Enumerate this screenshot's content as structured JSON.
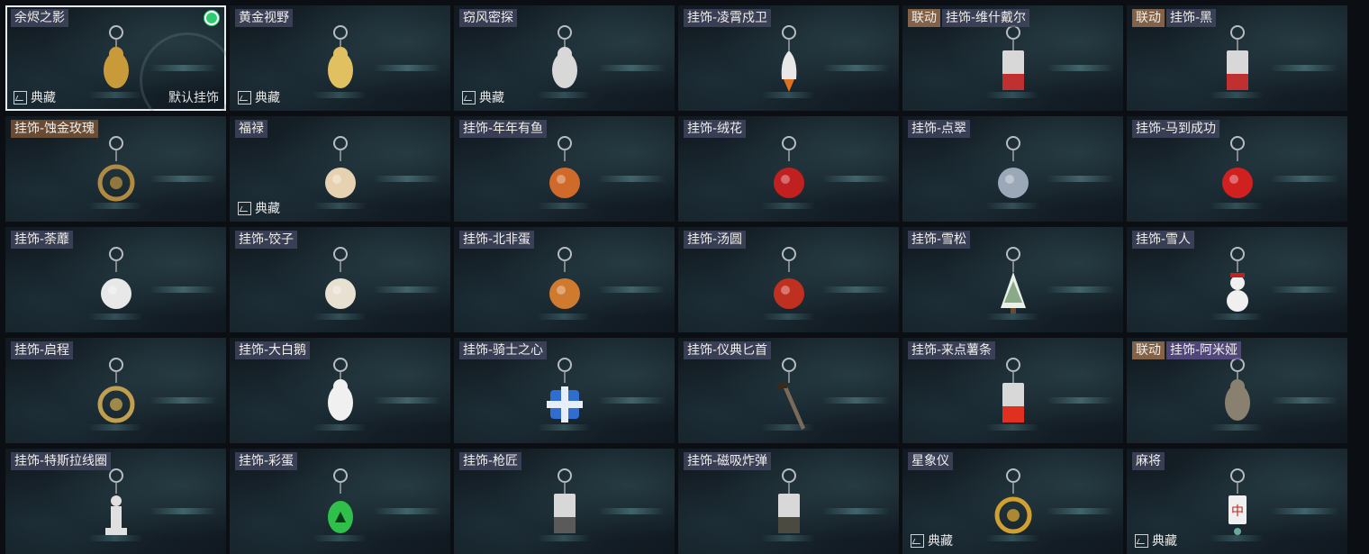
{
  "items": [
    {
      "name": "余烬之影",
      "collab": "",
      "tag": "",
      "collection": "典藏",
      "default_label": "默认挂饰",
      "selected": true,
      "icon": "ember-shadow-charm-icon",
      "color": "#c99a3a",
      "shape": "figure"
    },
    {
      "name": "黄金视野",
      "collab": "",
      "tag": "",
      "collection": "典藏",
      "icon": "golden-vision-charm-icon",
      "color": "#e0c060",
      "shape": "figure"
    },
    {
      "name": "窃风密探",
      "collab": "",
      "tag": "",
      "collection": "典藏",
      "icon": "wind-spy-charm-icon",
      "color": "#d8d8d8",
      "shape": "figure"
    },
    {
      "name": "挂饰-凌霄戍卫",
      "collab": "",
      "tag": "",
      "collection": "",
      "icon": "rocket-charm-icon",
      "color": "#e8e8e8",
      "shape": "rocket"
    },
    {
      "name": "挂饰-维什戴尔",
      "collab": "联动",
      "tag": "",
      "collection": "",
      "icon": "card-charm-icon",
      "color": "#c03030",
      "shape": "card"
    },
    {
      "name": "挂饰-黑",
      "collab": "联动",
      "tag": "",
      "collection": "",
      "icon": "card-charm-icon",
      "color": "#c03030",
      "shape": "card"
    },
    {
      "name": "挂饰-蚀金玫瑰",
      "collab": "",
      "tag": "gold",
      "collection": "",
      "icon": "gold-rose-charm-icon",
      "color": "#b08a40",
      "shape": "ring"
    },
    {
      "name": "福禄",
      "collab": "",
      "tag": "",
      "collection": "典藏",
      "icon": "gourd-charm-icon",
      "color": "#e6d2b0",
      "shape": "round"
    },
    {
      "name": "挂饰-年年有鱼",
      "collab": "",
      "tag": "",
      "collection": "",
      "icon": "fish-charm-icon",
      "color": "#d06a2a",
      "shape": "round"
    },
    {
      "name": "挂饰-绒花",
      "collab": "",
      "tag": "",
      "collection": "",
      "icon": "rose-charm-icon",
      "color": "#c02020",
      "shape": "round"
    },
    {
      "name": "挂饰-点翠",
      "collab": "",
      "tag": "",
      "collection": "",
      "icon": "feather-charm-icon",
      "color": "#9aa8b8",
      "shape": "round"
    },
    {
      "name": "挂饰-马到成功",
      "collab": "",
      "tag": "",
      "collection": "",
      "icon": "horse-charm-icon",
      "color": "#d02020",
      "shape": "round"
    },
    {
      "name": "挂饰-荼蘼",
      "collab": "",
      "tag": "",
      "collection": "",
      "icon": "flower-charm-icon",
      "color": "#e8e8e8",
      "shape": "round"
    },
    {
      "name": "挂饰-饺子",
      "collab": "",
      "tag": "",
      "collection": "",
      "icon": "dumpling-charm-icon",
      "color": "#e8e0d0",
      "shape": "round"
    },
    {
      "name": "挂饰-北非蛋",
      "collab": "",
      "tag": "",
      "collection": "",
      "icon": "shakshuka-charm-icon",
      "color": "#d07a30",
      "shape": "round"
    },
    {
      "name": "挂饰-汤圆",
      "collab": "",
      "tag": "",
      "collection": "",
      "icon": "tangyuan-charm-icon",
      "color": "#c03020",
      "shape": "round"
    },
    {
      "name": "挂饰-雪松",
      "collab": "",
      "tag": "",
      "collection": "",
      "icon": "tree-charm-icon",
      "color": "#e8f0e8",
      "shape": "tree"
    },
    {
      "name": "挂饰-雪人",
      "collab": "",
      "tag": "",
      "collection": "",
      "icon": "snowman-charm-icon",
      "color": "#f0f0f0",
      "shape": "snowman"
    },
    {
      "name": "挂饰-启程",
      "collab": "",
      "tag": "",
      "collection": "",
      "icon": "medallion-charm-icon",
      "color": "#c0a050",
      "shape": "ring"
    },
    {
      "name": "挂饰-大白鹅",
      "collab": "",
      "tag": "",
      "collection": "",
      "icon": "goose-charm-icon",
      "color": "#f0f0f0",
      "shape": "figure"
    },
    {
      "name": "挂饰-骑士之心",
      "collab": "",
      "tag": "",
      "collection": "",
      "icon": "cross-charm-icon",
      "color": "#2f6ed0",
      "shape": "cross"
    },
    {
      "name": "挂饰-仪典匕首",
      "collab": "",
      "tag": "",
      "collection": "",
      "icon": "dagger-charm-icon",
      "color": "#7a6a5a",
      "shape": "dagger"
    },
    {
      "name": "挂饰-来点薯条",
      "collab": "",
      "tag": "",
      "collection": "",
      "icon": "fries-charm-icon",
      "color": "#e03020",
      "shape": "card"
    },
    {
      "name": "挂饰-阿米娅",
      "collab": "联动",
      "tag": "purple",
      "collection": "",
      "icon": "amiya-charm-icon",
      "color": "#8a8070",
      "shape": "figure"
    },
    {
      "name": "挂饰-特斯拉线圈",
      "collab": "",
      "tag": "",
      "collection": "",
      "icon": "tesla-coil-charm-icon",
      "color": "#e0e0e0",
      "shape": "tower"
    },
    {
      "name": "挂饰-彩蛋",
      "collab": "",
      "tag": "",
      "collection": "",
      "icon": "egg-charm-icon",
      "color": "#2fbf4a",
      "shape": "egg"
    },
    {
      "name": "挂饰-枪匠",
      "collab": "",
      "tag": "",
      "collection": "",
      "icon": "bag-charm-icon",
      "color": "#5a5a5a",
      "shape": "card"
    },
    {
      "name": "挂饰-磁吸炸弹",
      "collab": "",
      "tag": "",
      "collection": "",
      "icon": "bomb-charm-icon",
      "color": "#4a4a40",
      "shape": "card"
    },
    {
      "name": "星象仪",
      "collab": "",
      "tag": "",
      "collection": "典藏",
      "icon": "astrolabe-charm-icon",
      "color": "#d0a030",
      "shape": "ring"
    },
    {
      "name": "麻将",
      "collab": "",
      "tag": "",
      "collection": "典藏",
      "icon": "mahjong-charm-icon",
      "color": "#f0f0f0",
      "shape": "tile"
    }
  ],
  "colors": {
    "selected_border": "#e8ecef",
    "status_dot": "#2ecc71"
  }
}
